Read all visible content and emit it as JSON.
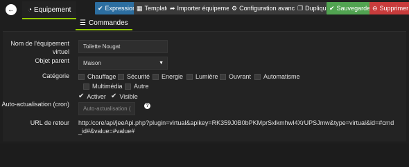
{
  "header": {
    "tab_equipement": "Equipement",
    "buttons": {
      "expression": "Expression",
      "template": "Template",
      "importer": "Importer équipement",
      "config": "Configuration avancée",
      "dupliquer": "Dupliquer",
      "sauvegarder": "Sauvegarder",
      "supprimer": "Supprimer"
    }
  },
  "subtab": {
    "commandes": "Commandes"
  },
  "form": {
    "nom_label": "Nom de l'équipement virtuel",
    "nom_value": "Toilette Nougat",
    "parent_label": "Objet parent",
    "parent_value": "Maison",
    "categorie_label": "Catégorie",
    "categories": [
      "Chauffage",
      "Sécurité",
      "Energie",
      "Lumière",
      "Ouvrant",
      "Automatisme",
      "Multimédia",
      "Autre"
    ],
    "activer": "Activer",
    "visible": "Visible",
    "cron_label": "Auto-actualisation (cron)",
    "cron_placeholder": "Auto-actualisation (",
    "url_label": "URL de retour",
    "url_value": "http:/core/api/jeeApi.php?plugin=virtual&apikey=RK359J0B0bPKMprSxlkmhwI4XrUPSJmw&type=virtual&id=#cmd_id#&value=#value#"
  }
}
